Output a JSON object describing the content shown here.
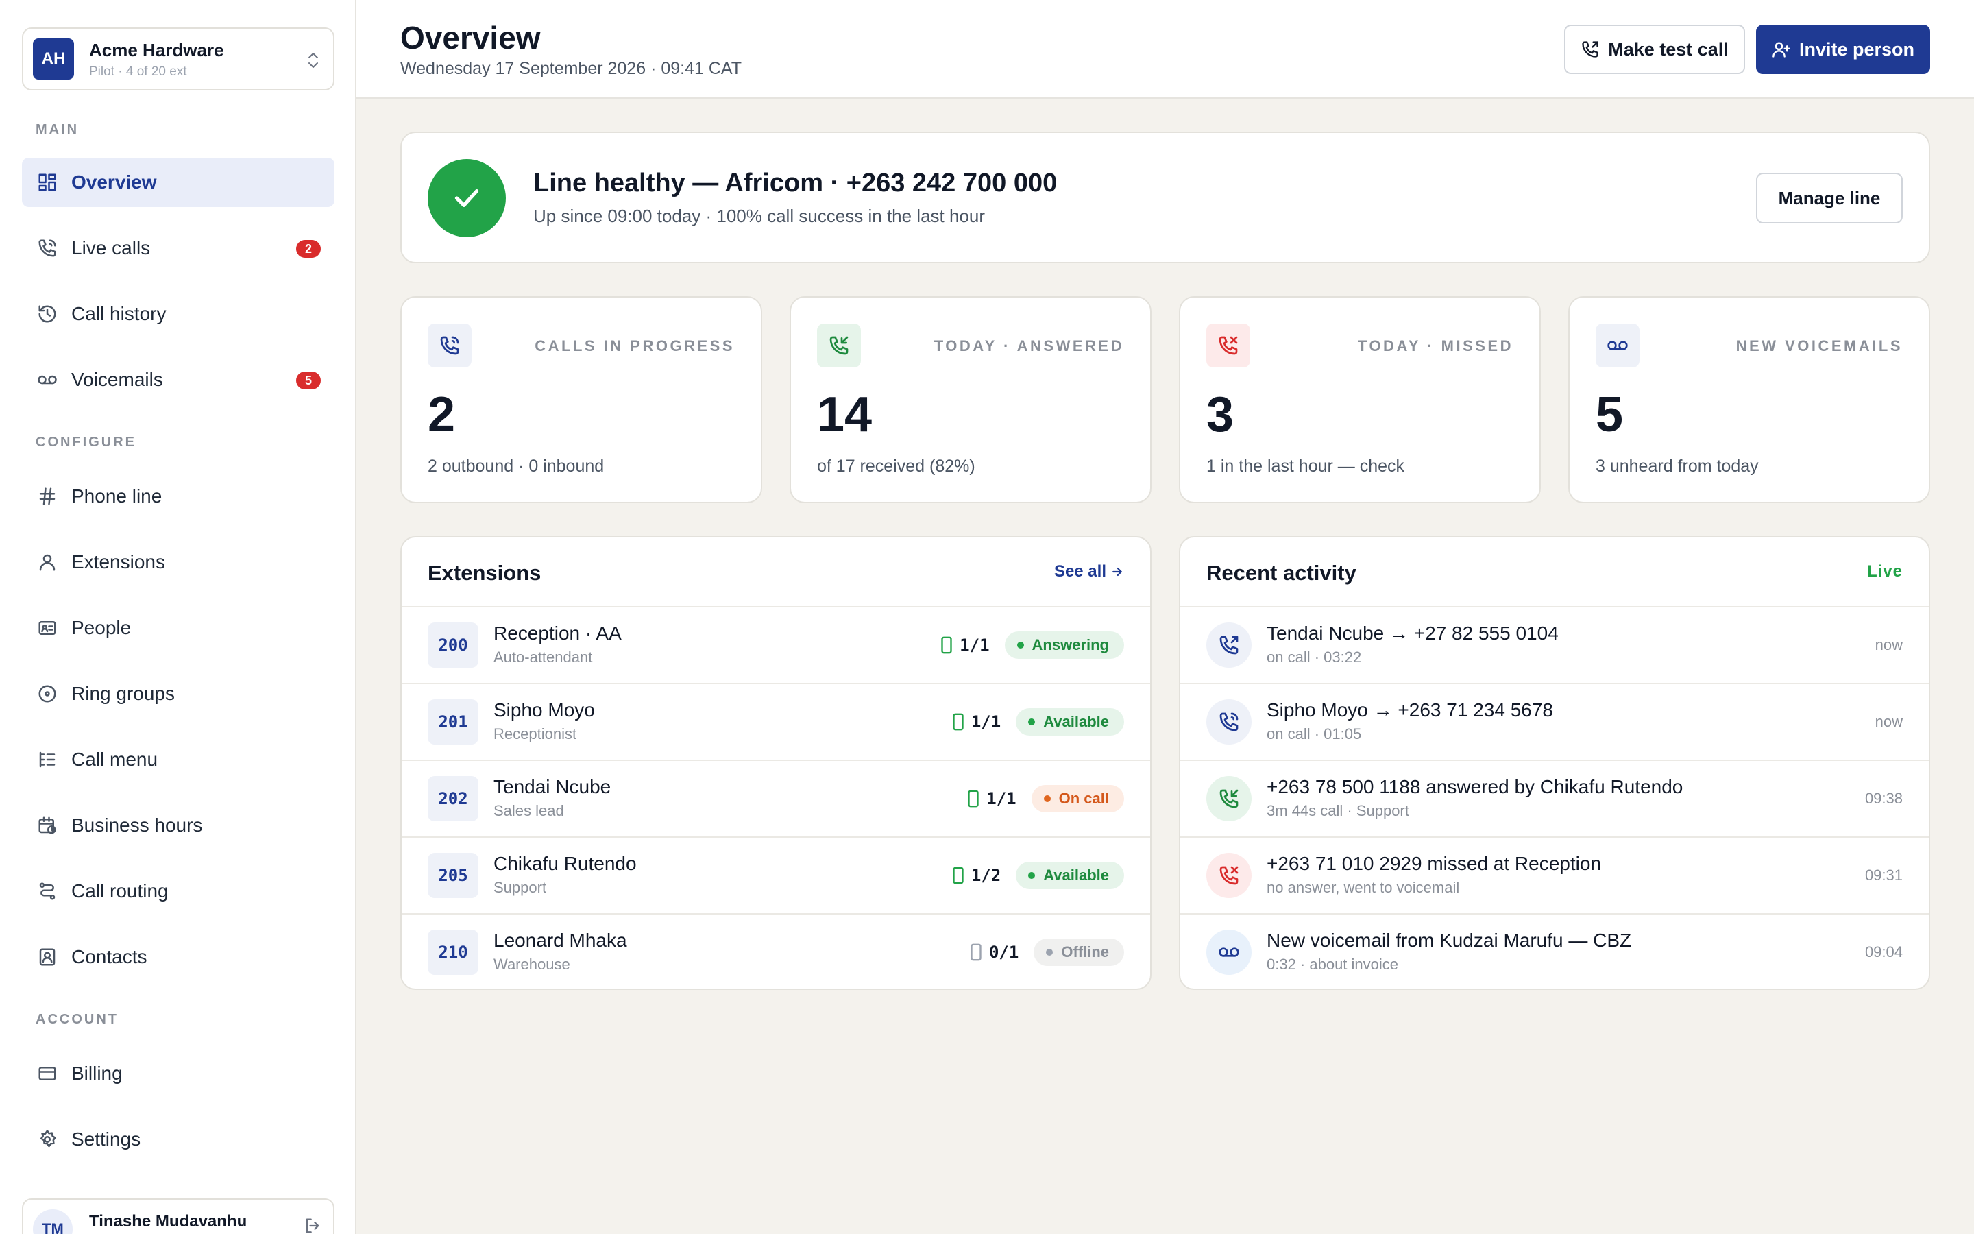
{
  "org": {
    "initials": "AH",
    "name": "Acme Hardware",
    "plan": "Pilot · 4 of 20 ext"
  },
  "nav": {
    "main_label": "MAIN",
    "configure_label": "CONFIGURE",
    "account_label": "ACCOUNT",
    "overview": "Overview",
    "live_calls": "Live calls",
    "live_calls_badge": "2",
    "call_history": "Call history",
    "voicemails": "Voicemails",
    "voicemails_badge": "5",
    "phone_line": "Phone line",
    "extensions": "Extensions",
    "people": "People",
    "ring_groups": "Ring groups",
    "call_menu": "Call menu",
    "business_hours": "Business hours",
    "call_routing": "Call routing",
    "contacts": "Contacts",
    "billing": "Billing",
    "settings": "Settings"
  },
  "user": {
    "initials": "TM",
    "name": "Tinashe Mudavanhu"
  },
  "header": {
    "title": "Overview",
    "date": "Wednesday 17 September 2026 · 09:41 CAT",
    "test_call_label": "Make test call",
    "invite_label": "Invite person"
  },
  "health": {
    "title": "Line healthy — Africom · +263 242 700 000",
    "subtitle": "Up since 09:00 today · 100% call success in the last hour",
    "manage_label": "Manage line"
  },
  "stats": [
    {
      "label": "CALLS IN PROGRESS",
      "value": "2",
      "note": "2 outbound · 0 inbound",
      "icon": "phone-icon"
    },
    {
      "label": "TODAY · ANSWERED",
      "value": "14",
      "note": "of 17 received (82%)",
      "icon": "phone-incoming-icon"
    },
    {
      "label": "TODAY · MISSED",
      "value": "3",
      "note": "1 in the last hour — check",
      "icon": "phone-missed-icon"
    },
    {
      "label": "NEW VOICEMAILS",
      "value": "5",
      "note": "3 unheard from today",
      "icon": "voicemail-icon"
    }
  ],
  "extensions_panel": {
    "title": "Extensions",
    "see_all": "See all",
    "rows": [
      {
        "number": "200",
        "name": "Reception · AA",
        "role": "Auto-attendant",
        "devices": "1/1",
        "status": "Answering"
      },
      {
        "number": "201",
        "name": "Sipho Moyo",
        "role": "Receptionist",
        "devices": "1/1",
        "status": "Available"
      },
      {
        "number": "202",
        "name": "Tendai Ncube",
        "role": "Sales lead",
        "devices": "1/1",
        "status": "On call"
      },
      {
        "number": "205",
        "name": "Chikafu Rutendo",
        "role": "Support",
        "devices": "1/2",
        "status": "Available"
      },
      {
        "number": "210",
        "name": "Leonard Mhaka",
        "role": "Warehouse",
        "devices": "0/1",
        "status": "Offline"
      }
    ]
  },
  "activity_panel": {
    "title": "Recent activity",
    "live_label": "Live",
    "rows": [
      {
        "title": "Tendai Ncube → +27 82 555 0104",
        "sub": "on call · 03:22",
        "time": "now",
        "icon": "phone-outgoing-icon"
      },
      {
        "title": "Sipho Moyo → +263 71 234 5678",
        "sub": "on call · 01:05",
        "time": "now",
        "icon": "phone-icon"
      },
      {
        "title": "+263 78 500 1188 answered by Chikafu Rutendo",
        "sub": "3m 44s call · Support",
        "time": "09:38",
        "icon": "phone-incoming-icon"
      },
      {
        "title": "+263 71 010 2929 missed at Reception",
        "sub": "no answer, went to voicemail",
        "time": "09:31",
        "icon": "phone-missed-icon"
      },
      {
        "title": "New voicemail from Kudzai Marufu — CBZ",
        "sub": "0:32 · about invoice",
        "time": "09:04",
        "icon": "voicemail-icon"
      }
    ]
  },
  "colors": {
    "accent": "#1f3a93",
    "success": "#22a348",
    "warning": "#e0661f",
    "danger": "#d92c2c",
    "background": "#f4f2ed"
  }
}
